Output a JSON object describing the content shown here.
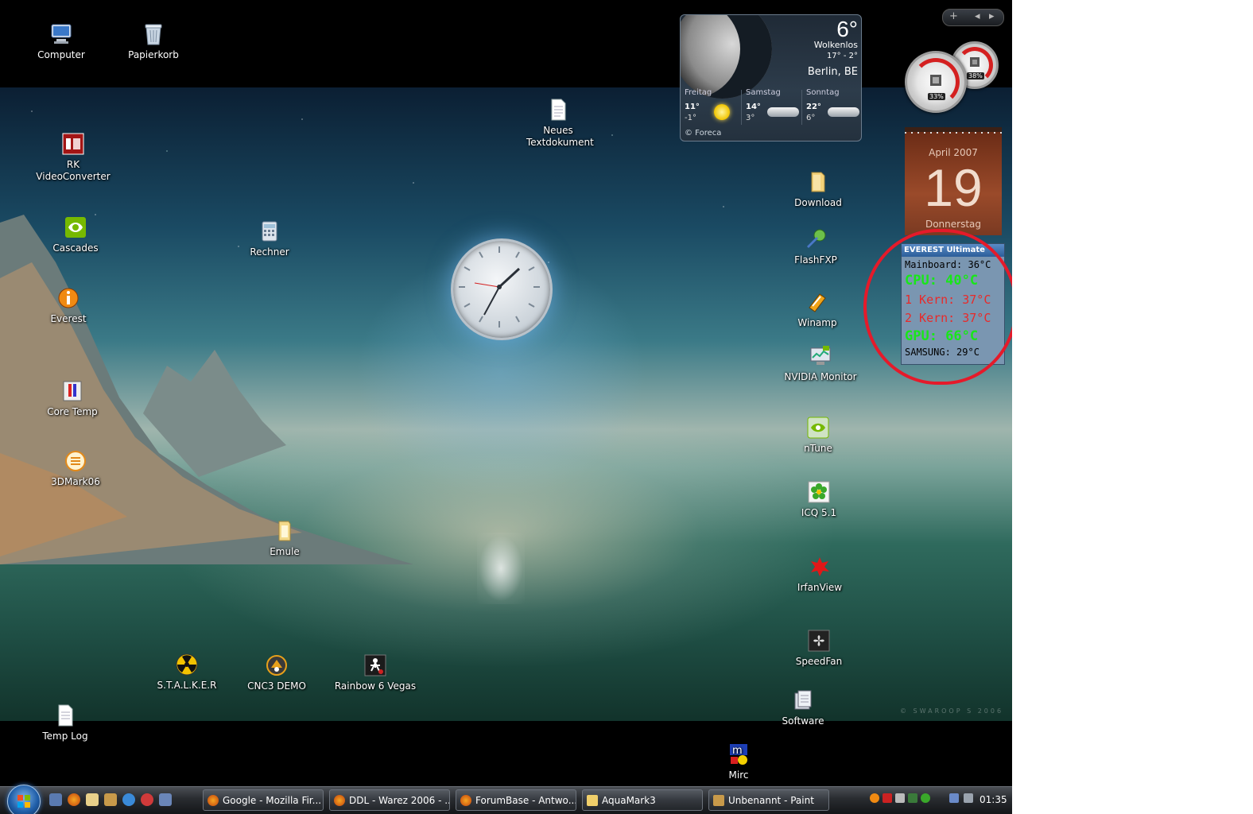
{
  "desktop_icons": [
    {
      "label": "Computer",
      "icon": "computer-icon"
    },
    {
      "label": "Papierkorb",
      "icon": "recycle-bin-icon"
    },
    {
      "label": "RK VideoConverter",
      "icon": "video-converter-icon"
    },
    {
      "label": "Cascades",
      "icon": "nvidia-icon"
    },
    {
      "label": "Everest",
      "icon": "everest-icon"
    },
    {
      "label": "Core Temp",
      "icon": "thermometer-icon"
    },
    {
      "label": "3DMark06",
      "icon": "benchmark-icon"
    },
    {
      "label": "Rechner",
      "icon": "calculator-icon"
    },
    {
      "label": "Neues Textdokument",
      "icon": "text-document-icon"
    },
    {
      "label": "Emule",
      "icon": "folder-shortcut-icon"
    },
    {
      "label": "S.T.A.L.K.E.R",
      "icon": "radiation-icon"
    },
    {
      "label": "CNC3 DEMO",
      "icon": "game-icon"
    },
    {
      "label": "Rainbow 6 Vegas",
      "icon": "soldier-icon"
    },
    {
      "label": "Temp Log",
      "icon": "text-document-icon"
    },
    {
      "label": "Download",
      "icon": "folder-icon"
    },
    {
      "label": "FlashFXP",
      "icon": "ftp-icon"
    },
    {
      "label": "Winamp",
      "icon": "winamp-icon"
    },
    {
      "label": "NVIDIA Monitor",
      "icon": "monitor-icon"
    },
    {
      "label": "nTune",
      "icon": "nvidia-icon"
    },
    {
      "label": "ICQ 5.1",
      "icon": "icq-flower-icon"
    },
    {
      "label": "IrfanView",
      "icon": "irfanview-icon"
    },
    {
      "label": "SpeedFan",
      "icon": "fan-icon"
    },
    {
      "label": "Software",
      "icon": "software-icon"
    },
    {
      "label": "Mirc",
      "icon": "mirc-icon"
    }
  ],
  "weather": {
    "temperature": "6°",
    "condition": "Wolkenlos",
    "range": "17° - 2°",
    "location": "Berlin, BE",
    "forecast": [
      {
        "day": "Freitag",
        "high": "11°",
        "low": "-1°",
        "icon": "sun-icon"
      },
      {
        "day": "Samstag",
        "high": "14°",
        "low": "3°",
        "icon": "cloud-icon"
      },
      {
        "day": "Sonntag",
        "high": "22°",
        "low": "6°",
        "icon": "cloud-icon"
      }
    ],
    "source": "© Foreca"
  },
  "cpu_meter": {
    "cpu_percent_label": "33%",
    "ram_percent_label": "38%",
    "cpu_level": 0.33,
    "ram_level": 0.38
  },
  "calendar": {
    "month_year": "April 2007",
    "day": "19",
    "weekday": "Donnerstag"
  },
  "everest": {
    "title": "EVEREST Ultimate",
    "rows": [
      {
        "text": "Mainboard: 36°C",
        "color": "#000000"
      },
      {
        "text": "CPU: 40°C",
        "color": "#19e619"
      },
      {
        "text": "1 Kern: 37°C",
        "color": "#e82a2a"
      },
      {
        "text": "2 Kern: 37°C",
        "color": "#e82a2a"
      },
      {
        "text": "GPU: 66°C",
        "color": "#19e619"
      },
      {
        "text": "SAMSUNG: 29°C",
        "color": "#000000"
      }
    ],
    "highlight_color": "#e51a2a"
  },
  "sidebar_controls": {
    "add": "+",
    "prev": "◂",
    "next": "▸"
  },
  "wallpaper_credit": "© SWAROOP S 2006",
  "taskbar": {
    "tasks": [
      {
        "label": "Google - Mozilla Fir...",
        "icon": "firefox-icon"
      },
      {
        "label": "DDL - Warez 2006 - ...",
        "icon": "firefox-icon"
      },
      {
        "label": "ForumBase - Antwo...",
        "icon": "firefox-icon"
      },
      {
        "label": "AquaMark3",
        "icon": "folder-icon"
      },
      {
        "label": "Unbenannt - Paint",
        "icon": "paint-icon"
      }
    ],
    "clock": "01:35"
  }
}
